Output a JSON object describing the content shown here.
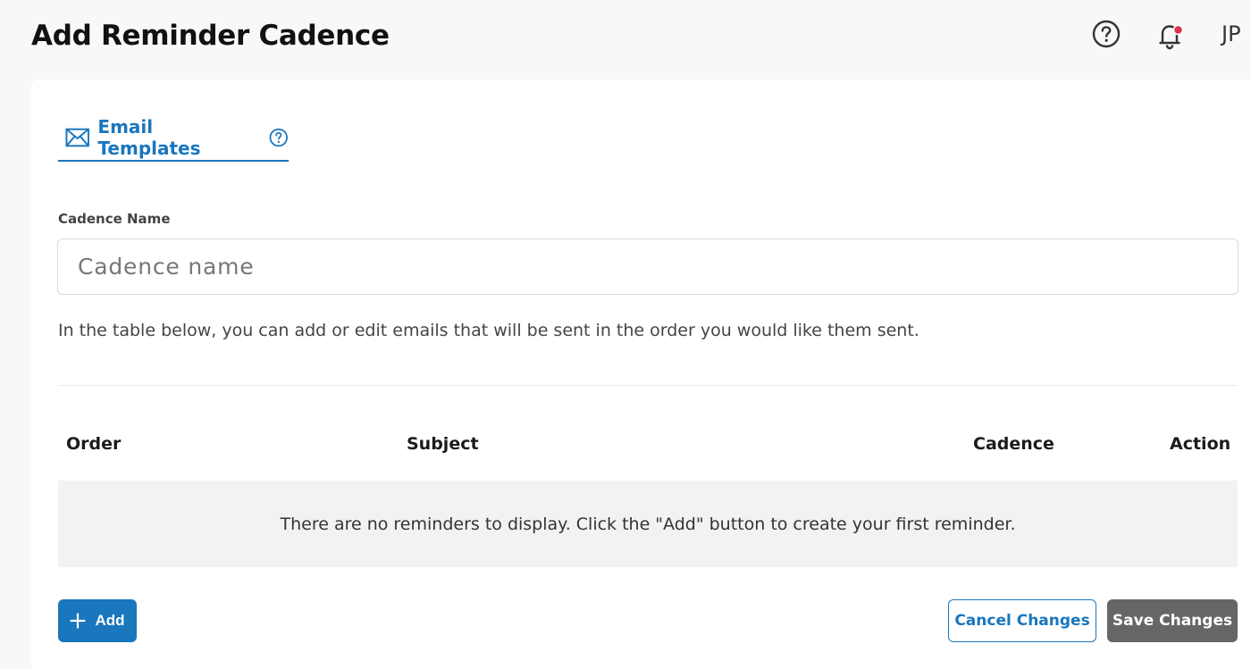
{
  "header": {
    "title": "Add Reminder Cadence",
    "avatar_initials": "JP"
  },
  "tab": {
    "label": "Email Templates"
  },
  "form": {
    "cadence_label": "Cadence Name",
    "cadence_placeholder": "Cadence name",
    "help_text": "In the table below, you can add or edit emails that will be sent in the order you would like them sent."
  },
  "table": {
    "columns": [
      "Order",
      "Subject",
      "Cadence",
      "Action"
    ],
    "empty_message": "There are no reminders to display. Click the \"Add\" button to create your first reminder."
  },
  "actions": {
    "add_label": "Add",
    "cancel_label": "Cancel Changes",
    "save_label": "Save Changes"
  },
  "colors": {
    "accent": "#1a76bd",
    "notification_dot": "#d9334d",
    "save_button": "#666666"
  },
  "icons": {
    "help": "help-circle-icon",
    "bell": "bell-icon",
    "email": "envelope-icon",
    "add": "plus-icon"
  }
}
